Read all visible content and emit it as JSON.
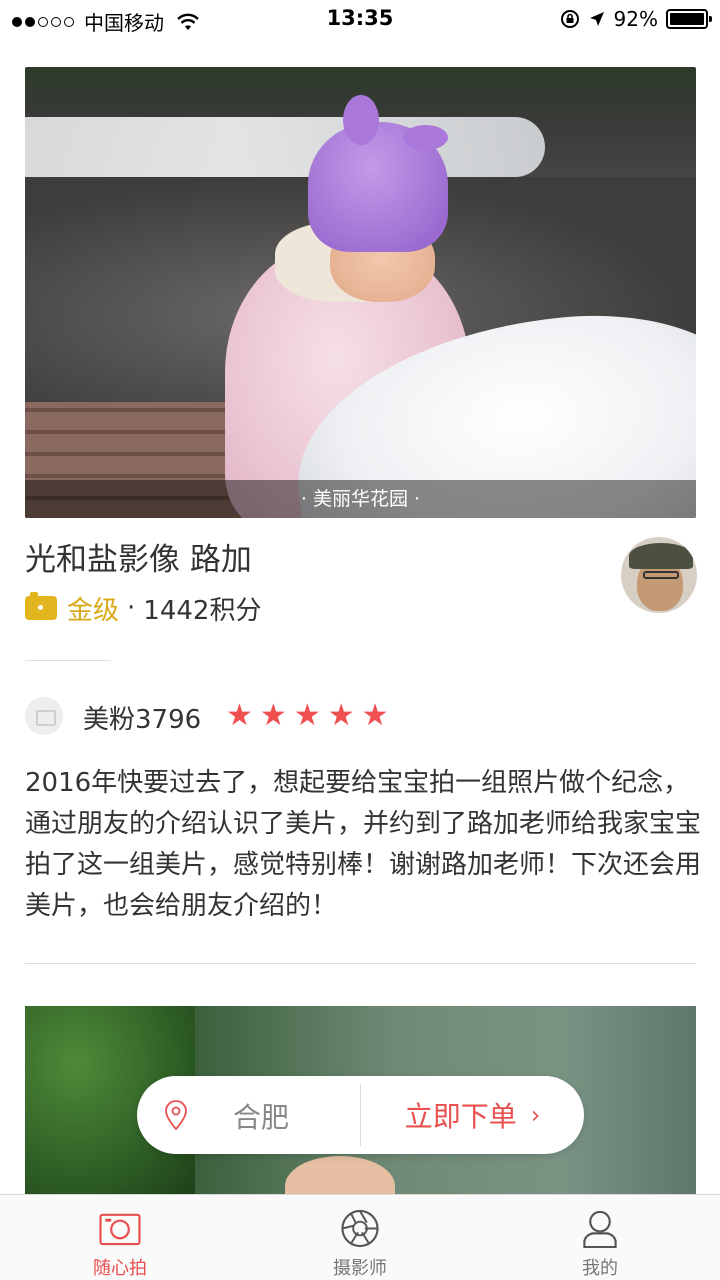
{
  "status_bar": {
    "carrier": "中国移动",
    "time": "13:35",
    "battery": "92%"
  },
  "feature_photo": {
    "caption": "· 美丽华花园 ·"
  },
  "photographer": {
    "name": "光和盐影像 路加",
    "level": "金级",
    "separator": "·",
    "points": "1442积分"
  },
  "review": {
    "reviewer": "美粉3796",
    "rating": 5,
    "stars": [
      "★",
      "★",
      "★",
      "★",
      "★"
    ],
    "text": "2016年快要过去了，想起要给宝宝拍一组照片做个纪念，通过朋友的介绍认识了美片，并约到了路加老师给我家宝宝拍了这一组美片，感觉特别棒！谢谢路加老师！下次还会用美片，也会给朋友介绍的！"
  },
  "float_bar": {
    "city": "合肥",
    "order_label": "立即下单",
    "chevron": "›"
  },
  "tabs": [
    {
      "label": "随心拍",
      "icon": "camera-icon",
      "active": true
    },
    {
      "label": "摄影师",
      "icon": "aperture-icon",
      "active": false
    },
    {
      "label": "我的",
      "icon": "person-icon",
      "active": false
    }
  ],
  "colors": {
    "accent": "#e84e4e",
    "star": "#f05050",
    "gold": "#d9a917"
  }
}
